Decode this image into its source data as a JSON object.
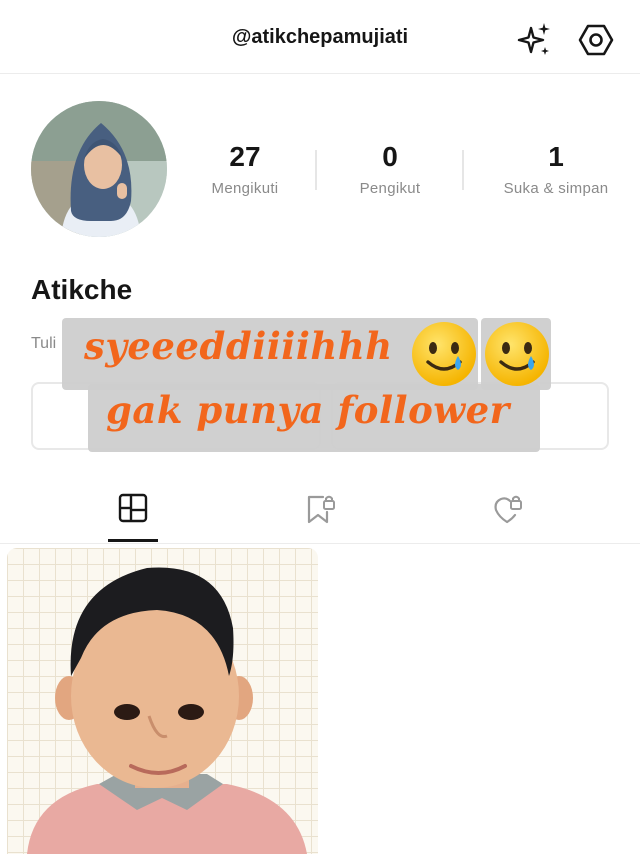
{
  "header": {
    "handle": "@atikchepamujiati",
    "icons": [
      "sparkle-icon",
      "settings-hexagon-icon"
    ]
  },
  "profile": {
    "name": "Atikche",
    "bio": "Tuli",
    "stats": [
      {
        "value": "27",
        "label": "Mengikuti"
      },
      {
        "value": "0",
        "label": "Pengikut"
      },
      {
        "value": "1",
        "label": "Suka & simpan"
      }
    ]
  },
  "overlay": {
    "line1": "syeeeddiiiihhh",
    "line2": "gak punya follower",
    "emoji": "smiling-face-with-tear",
    "text_color": "#f2661c"
  },
  "tabs": [
    {
      "name": "posts-grid",
      "icon": "grid-icon",
      "active": true
    },
    {
      "name": "saved-locked",
      "icon": "bookmark-lock-icon",
      "active": false
    },
    {
      "name": "liked-locked",
      "icon": "heart-lock-icon",
      "active": false
    }
  ],
  "posts": [
    {
      "type": "photo",
      "subject": "child-portrait"
    }
  ]
}
